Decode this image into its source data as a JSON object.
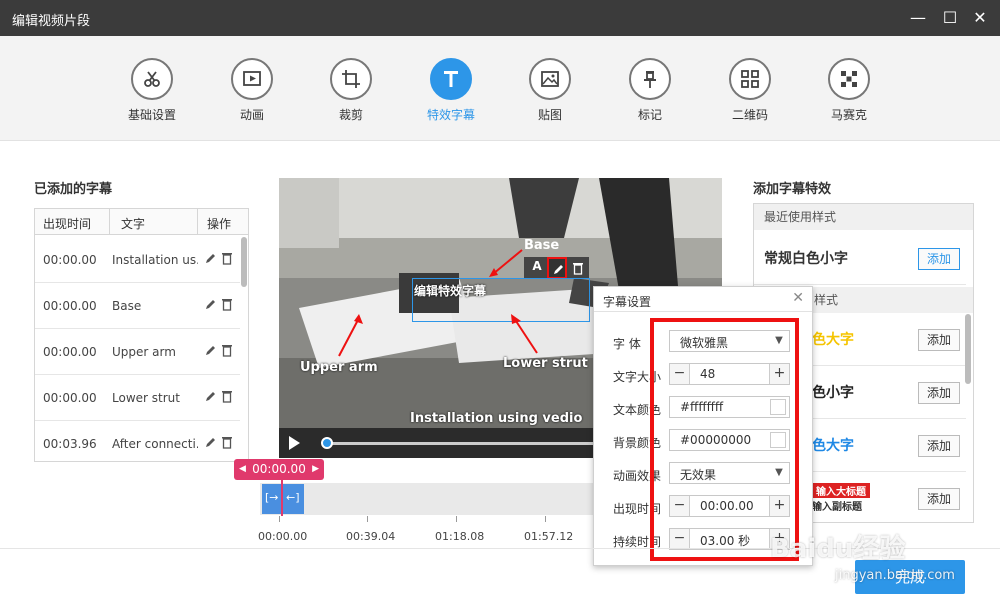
{
  "window": {
    "title": "编辑视频片段",
    "min_glyph": "—",
    "max_glyph": "☐",
    "close_glyph": "✕"
  },
  "toolbar": {
    "tabs": [
      {
        "label": "基础设置",
        "icon": "scissors-icon"
      },
      {
        "label": "动画",
        "icon": "play-frame-icon"
      },
      {
        "label": "裁剪",
        "icon": "crop-icon"
      },
      {
        "label": "特效字幕",
        "icon": "text-t-icon",
        "active": true
      },
      {
        "label": "贴图",
        "icon": "image-icon"
      },
      {
        "label": "标记",
        "icon": "pin-icon"
      },
      {
        "label": "二维码",
        "icon": "qrcode-icon"
      },
      {
        "label": "马赛克",
        "icon": "mosaic-icon"
      }
    ]
  },
  "subtitles": {
    "title": "已添加的字幕",
    "columns": [
      "出现时间",
      "文字",
      "操作"
    ],
    "rows": [
      {
        "time": "00:00.00",
        "text": "Installation us..."
      },
      {
        "time": "00:00.00",
        "text": "Base"
      },
      {
        "time": "00:00.00",
        "text": "Upper arm"
      },
      {
        "time": "00:00.00",
        "text": "Lower strut"
      },
      {
        "time": "00:03.96",
        "text": "After connecti..."
      }
    ]
  },
  "video": {
    "captions": {
      "base": "Base",
      "edit_caption": "编辑特效字幕",
      "upper_arm": "Upper arm",
      "lower_strut": "Lower strut",
      "installation": "Installation using vedio"
    },
    "caption_toolbar": {
      "text_btn": "A"
    }
  },
  "timeline": {
    "marker_time": "00:00.00",
    "ticks": [
      "00:00.00",
      "00:39.04",
      "01:18.08",
      "01:57.12"
    ]
  },
  "effects": {
    "title": "添加字幕特效",
    "recent_label": "最近使用样式",
    "recent_sample": "常规白色小字",
    "section2_label": "样式",
    "items": [
      {
        "sample": "色大字",
        "color": "#f5c400"
      },
      {
        "sample": "色小字",
        "color": "#222222"
      },
      {
        "sample": "色大字",
        "color": "#1e88e5"
      },
      {
        "sample_top": "输入大标题",
        "sample_bottom": "输入副标题"
      }
    ],
    "add_label": "添加"
  },
  "dialog": {
    "title": "字幕设置",
    "close": "✕",
    "rows": [
      {
        "label": "字    体",
        "value": "微软雅黑",
        "kind": "select"
      },
      {
        "label": "文字大小",
        "value": "48",
        "kind": "stepper"
      },
      {
        "label": "文本颜色",
        "value": "#ffffffff",
        "kind": "color"
      },
      {
        "label": "背景颜色",
        "value": "#00000000",
        "kind": "color"
      },
      {
        "label": "动画效果",
        "value": "无效果",
        "kind": "select"
      },
      {
        "label": "出现时间",
        "value": "00:00.00",
        "kind": "stepper"
      },
      {
        "label": "持续时间",
        "value": "03.00 秒",
        "kind": "stepper"
      }
    ]
  },
  "footer": {
    "done_label": "完成"
  },
  "watermark": {
    "brand": "Baidu经验",
    "url": "jingyan.baidu.com"
  },
  "colors": {
    "accent": "#2d96e8",
    "marker": "#e0396c",
    "highlight": "#ee1111"
  }
}
